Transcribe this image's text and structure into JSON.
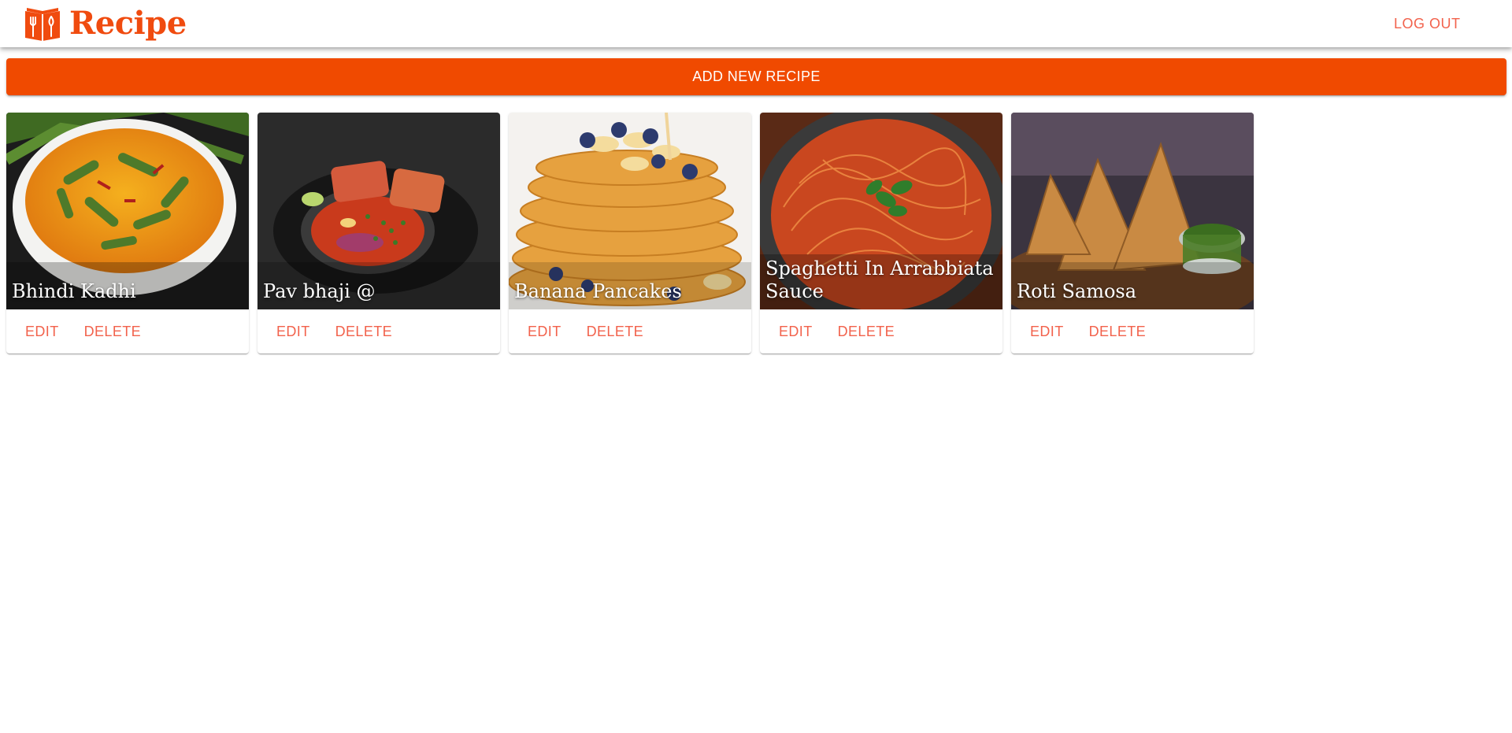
{
  "app": {
    "title": "Recipe",
    "logo_icon": "recipe-book-icon"
  },
  "header": {
    "logout_label": "LOG OUT"
  },
  "main": {
    "add_button_label": "ADD NEW RECIPE"
  },
  "cards": [
    {
      "title": "Bhindi Kadhi",
      "edit_label": "EDIT",
      "delete_label": "DELETE"
    },
    {
      "title": "Pav bhaji @",
      "edit_label": "EDIT",
      "delete_label": "DELETE"
    },
    {
      "title": "Banana Pancakes",
      "edit_label": "EDIT",
      "delete_label": "DELETE"
    },
    {
      "title": "Spaghetti In Arrabbiata Sauce",
      "edit_label": "EDIT",
      "delete_label": "DELETE"
    },
    {
      "title": "Roti Samosa",
      "edit_label": "EDIT",
      "delete_label": "DELETE"
    }
  ],
  "colors": {
    "brand": "#f04b0f",
    "button": "#f04a00",
    "action_text": "#f2624c"
  }
}
